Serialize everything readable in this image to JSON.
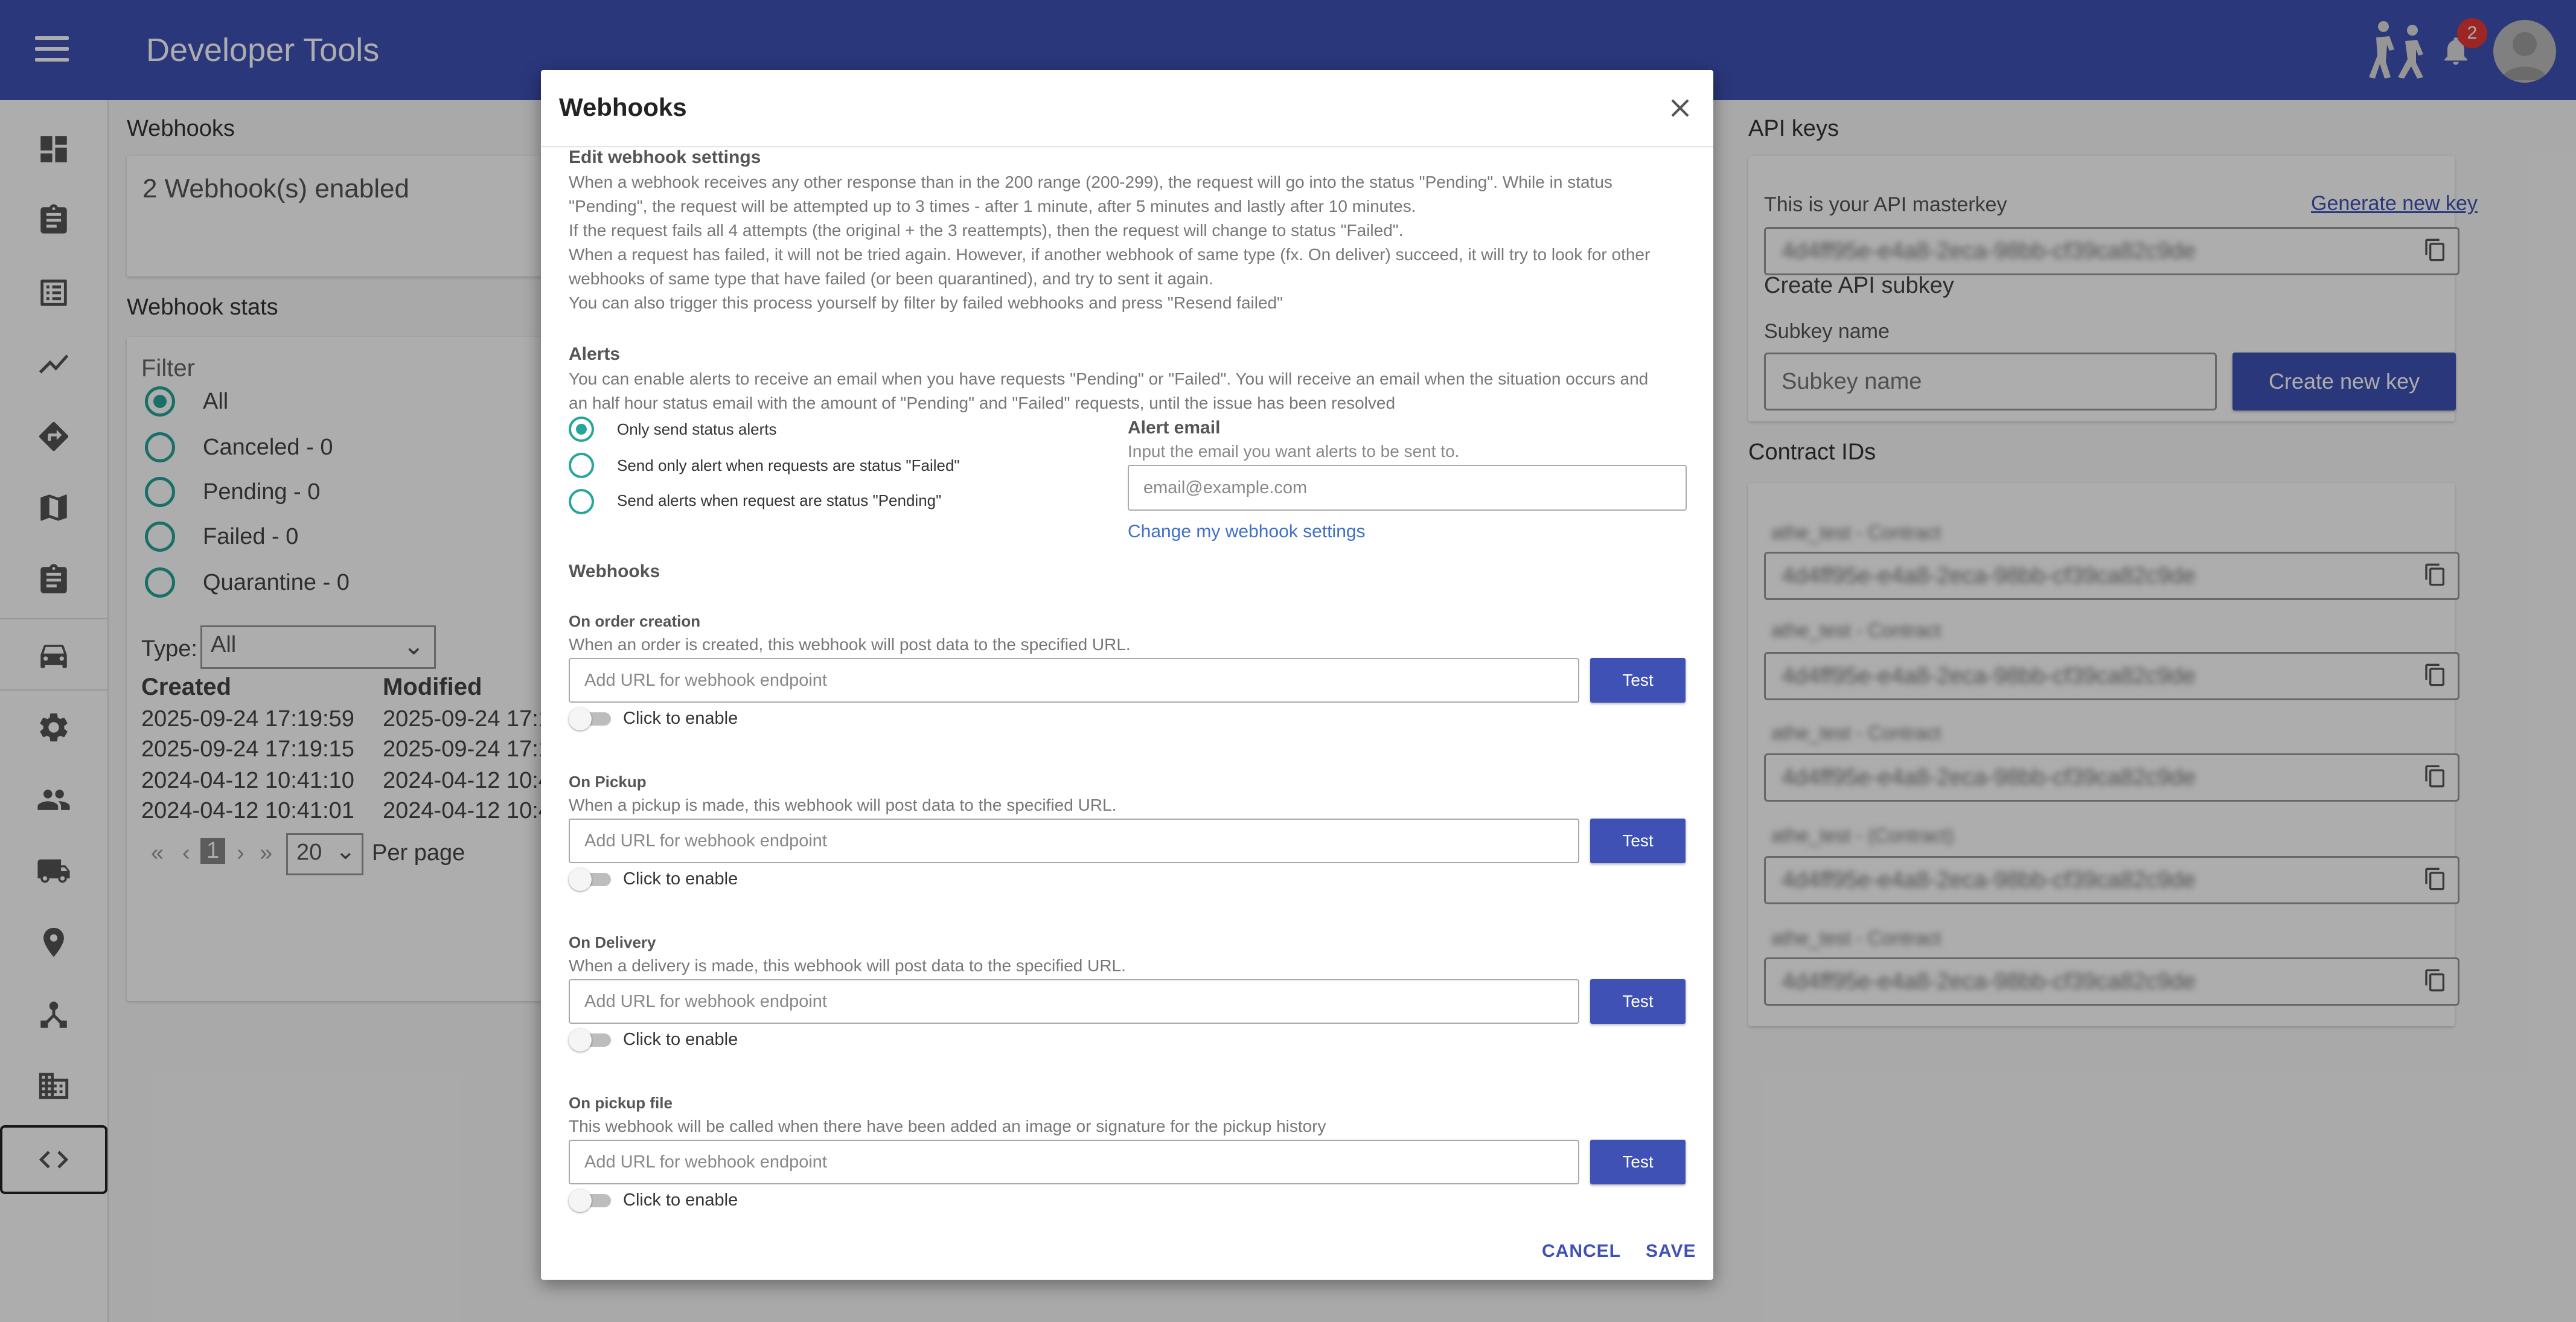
{
  "app": {
    "title": "Developer Tools",
    "notification_count": "2"
  },
  "sidebar": {
    "items": [
      "dashboard",
      "clipboard",
      "list",
      "chart",
      "directions",
      "map",
      "assignment",
      "car",
      "settings",
      "people",
      "truck",
      "location",
      "hierarchy",
      "business",
      "code"
    ]
  },
  "background": {
    "webhooks_title": "Webhooks",
    "webhooks_enabled": "2 Webhook(s) enabled",
    "stats_title": "Webhook stats",
    "filter_label": "Filter",
    "filters": [
      "All",
      "Canceled - 0",
      "Pending - 0",
      "Failed - 0",
      "Quarantine - 0"
    ],
    "type_label": "Type:",
    "type_value": "All",
    "table_headers": [
      "Created",
      "Modified"
    ],
    "table_rows": [
      [
        "2025-09-24 17:19:59",
        "2025-09-24 17:1"
      ],
      [
        "2025-09-24 17:19:15",
        "2025-09-24 17:1"
      ],
      [
        "2024-04-12 10:41:10",
        "2024-04-12 10:4"
      ],
      [
        "2024-04-12 10:41:01",
        "2024-04-12 10:4"
      ]
    ],
    "pagination": {
      "first": "«",
      "prev": "‹",
      "page": "1",
      "next": "›",
      "last": "»",
      "per_page": "20",
      "per_page_label": "Per page"
    },
    "api_keys_title": "API keys",
    "masterkey_label": "This is your API masterkey",
    "generate_link": "Generate new key",
    "masterkey_value": "4d4ff95e-e4a8-2eca-98bb-cf39ca82c9de",
    "create_subkey_title": "Create API subkey",
    "subkey_label": "Subkey name",
    "subkey_placeholder": "Subkey name",
    "create_key_button": "Create new key",
    "contract_ids_title": "Contract IDs",
    "contracts": [
      {
        "label": "athe_test - Contract",
        "value": "4d4ff95e-e4a8-2eca-98bb-cf39ca82c9de"
      },
      {
        "label": "athe_test - Contract",
        "value": "4d4ff95e-e4a8-2eca-98bb-cf39ca82c9de"
      },
      {
        "label": "athe_test - Contract",
        "value": "4d4ff95e-e4a8-2eca-98bb-cf39ca82c9de"
      },
      {
        "label": "athe_test - (Contract)",
        "value": "4d4ff95e-e4a8-2eca-98bb-cf39ca82c9de"
      },
      {
        "label": "athe_test - Contract",
        "value": "4d4ff95e-e4a8-2eca-98bb-cf39ca82c9de"
      }
    ]
  },
  "modal": {
    "title": "Webhooks",
    "edit_heading": "Edit webhook settings",
    "edit_lines": [
      "When a webhook receives any other response than in the 200 range (200-299), the request will go into the status \"Pending\". While in status",
      "\"Pending\", the request will be attempted up to 3 times - after 1 minute, after 5 minutes and lastly after 10 minutes.",
      "If the request fails all 4 attempts (the original + the 3 reattempts), then the request will change to status \"Failed\".",
      "When a request has failed, it will not be tried again. However, if another webhook of same type (fx. On deliver) succeed, it will try to look for other",
      "webhooks of same type that have failed (or been quarantined), and try to sent it again.",
      "You can also trigger this process yourself by filter by failed webhooks and press \"Resend failed\""
    ],
    "alerts_heading": "Alerts",
    "alerts_lines": [
      "You can enable alerts to receive an email when you have requests \"Pending\" or \"Failed\". You will receive an email when the situation occurs and",
      "an half hour status email with the amount of \"Pending\" and \"Failed\" requests, until the issue has been resolved"
    ],
    "alert_options": [
      "Only send status alerts",
      "Send only alert when requests are status \"Failed\"",
      "Send alerts when request are status \"Pending\""
    ],
    "alert_email_label": "Alert email",
    "alert_email_hint": "Input the email you want alerts to be sent to.",
    "alert_email_placeholder": "email@example.com",
    "change_settings_link": "Change my webhook settings",
    "webhooks_heading": "Webhooks",
    "webhooks": [
      {
        "name": "On order creation",
        "desc": "When an order is created, this webhook will post data to the specified URL.",
        "placeholder": "Add URL for webhook endpoint",
        "test": "Test",
        "toggle": "Click to enable"
      },
      {
        "name": "On Pickup",
        "desc": "When a pickup is made, this webhook will post data to the specified URL.",
        "placeholder": "Add URL for webhook endpoint",
        "test": "Test",
        "toggle": "Click to enable"
      },
      {
        "name": "On Delivery",
        "desc": "When a delivery is made, this webhook will post data to the specified URL.",
        "placeholder": "Add URL for webhook endpoint",
        "test": "Test",
        "toggle": "Click to enable"
      },
      {
        "name": "On pickup file",
        "desc": "This webhook will be called when there have been added an image or signature for the pickup history",
        "placeholder": "Add URL for webhook endpoint",
        "test": "Test",
        "toggle": "Click to enable"
      }
    ],
    "cancel": "CANCEL",
    "save": "SAVE"
  },
  "colors": {
    "primary": "#3f51b5",
    "radio": "#26a69a",
    "badge": "#e53935"
  }
}
